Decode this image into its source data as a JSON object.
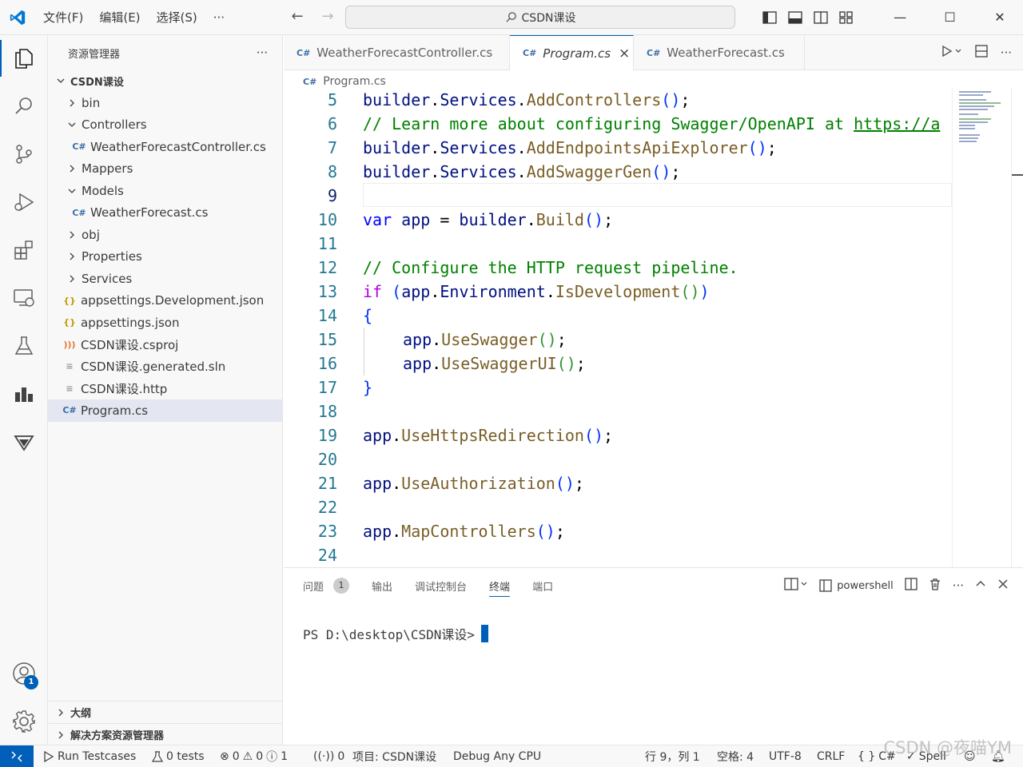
{
  "titlebar": {
    "menu": [
      "文件(F)",
      "编辑(E)",
      "选择(S)",
      "···"
    ],
    "search": "CSDN课设"
  },
  "sidebar": {
    "title": "资源管理器",
    "more": "···",
    "root": "CSDN课设",
    "items": [
      {
        "label": "bin",
        "type": "folder",
        "expanded": false,
        "depth": 1
      },
      {
        "label": "Controllers",
        "type": "folder",
        "expanded": true,
        "depth": 1
      },
      {
        "label": "WeatherForecastController.cs",
        "type": "cs",
        "depth": 2
      },
      {
        "label": "Mappers",
        "type": "folder",
        "expanded": false,
        "depth": 1
      },
      {
        "label": "Models",
        "type": "folder",
        "expanded": true,
        "depth": 1
      },
      {
        "label": "WeatherForecast.cs",
        "type": "cs",
        "depth": 2
      },
      {
        "label": "obj",
        "type": "folder",
        "expanded": false,
        "depth": 1
      },
      {
        "label": "Properties",
        "type": "folder",
        "expanded": false,
        "depth": 1
      },
      {
        "label": "Services",
        "type": "folder",
        "expanded": false,
        "depth": 1
      },
      {
        "label": "appsettings.Development.json",
        "type": "json",
        "depth": 1
      },
      {
        "label": "appsettings.json",
        "type": "json",
        "depth": 1
      },
      {
        "label": "CSDN课设.csproj",
        "type": "rss",
        "depth": 1
      },
      {
        "label": "CSDN课设.generated.sln",
        "type": "lines",
        "depth": 1
      },
      {
        "label": "CSDN课设.http",
        "type": "lines",
        "depth": 1
      },
      {
        "label": "Program.cs",
        "type": "cs",
        "depth": 1,
        "selected": true
      }
    ],
    "outline": "大纲",
    "solution_explorer": "解决方案资源管理器"
  },
  "activity": {
    "accounts_badge": "1"
  },
  "tabs": [
    {
      "label": "WeatherForecastController.cs",
      "active": false
    },
    {
      "label": "Program.cs",
      "active": true,
      "close": "×"
    },
    {
      "label": "WeatherForecast.cs",
      "active": false
    }
  ],
  "breadcrumb": "Program.cs",
  "editor": {
    "current_line": 9,
    "lines": [
      {
        "n": "5"
      },
      {
        "n": "6"
      },
      {
        "n": "7"
      },
      {
        "n": "8"
      },
      {
        "n": "9"
      },
      {
        "n": "10"
      },
      {
        "n": "11"
      },
      {
        "n": "12"
      },
      {
        "n": "13"
      },
      {
        "n": "14"
      },
      {
        "n": "15"
      },
      {
        "n": "16"
      },
      {
        "n": "17"
      },
      {
        "n": "18"
      },
      {
        "n": "19"
      },
      {
        "n": "20"
      },
      {
        "n": "21"
      },
      {
        "n": "22"
      },
      {
        "n": "23"
      },
      {
        "n": "24"
      }
    ],
    "code": {
      "l5": [
        "builder",
        ".",
        "Services",
        ".",
        "AddControllers",
        "(",
        ")",
        ";"
      ],
      "l6": "// Learn more about configuring Swagger/OpenAPI at ",
      "l6_link": "https://a",
      "l7": [
        "builder",
        ".",
        "Services",
        ".",
        "AddEndpointsApiExplorer",
        "(",
        ")",
        ";"
      ],
      "l8": [
        "builder",
        ".",
        "Services",
        ".",
        "AddSwaggerGen",
        "(",
        ")",
        ";"
      ],
      "l10": [
        "var",
        " ",
        "app",
        " = ",
        "builder",
        ".",
        "Build",
        "(",
        ")",
        ";"
      ],
      "l12": "// Configure the HTTP request pipeline.",
      "l13": [
        "if",
        " ",
        "(",
        "app",
        ".",
        "Environment",
        ".",
        "IsDevelopment",
        "(",
        ")",
        ")"
      ],
      "l14": "{",
      "l15": [
        "app",
        ".",
        "UseSwagger",
        "(",
        ")",
        ";"
      ],
      "l16": [
        "app",
        ".",
        "UseSwaggerUI",
        "(",
        ")",
        ";"
      ],
      "l17": "}",
      "l19": [
        "app",
        ".",
        "UseHttpsRedirection",
        "(",
        ")",
        ";"
      ],
      "l21": [
        "app",
        ".",
        "UseAuthorization",
        "(",
        ")",
        ";"
      ],
      "l23": [
        "app",
        ".",
        "MapControllers",
        "(",
        ")",
        ";"
      ]
    }
  },
  "panel": {
    "tabs": [
      "问题",
      "输出",
      "调试控制台",
      "终端",
      "端口"
    ],
    "problems_count": "1",
    "active_tab": "终端",
    "shell": "powershell",
    "prompt": "PS D:\\desktop\\CSDN课设>"
  },
  "statusbar": {
    "run_testcases": "Run Testcases",
    "tests": "0 tests",
    "errors": "0",
    "warnings": "0",
    "info": "1",
    "ports": "0",
    "project": "项目: CSDN课设",
    "config": "Debug Any CPU",
    "position": "行 9，列 1",
    "spaces": "空格: 4",
    "encoding": "UTF-8",
    "eol": "CRLF",
    "language": "C#",
    "spell": "Spell"
  },
  "watermark": "CSDN @夜喵YM",
  "colors": {
    "accent": "#005fb8",
    "keyword": "#0000ff",
    "control": "#af00db",
    "comment": "#008000",
    "method": "#795e26",
    "variable": "#001080",
    "linenumber": "#237893"
  }
}
